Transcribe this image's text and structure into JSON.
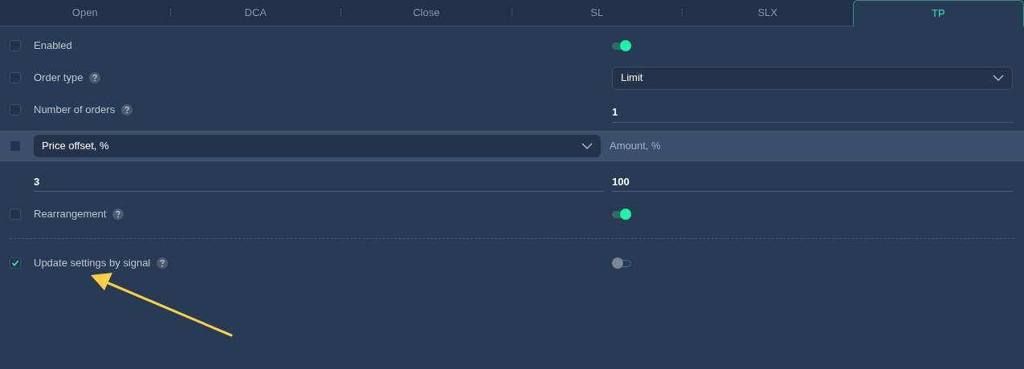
{
  "tabs": [
    {
      "label": "Open",
      "selected": false
    },
    {
      "label": "DCA",
      "selected": false
    },
    {
      "label": "Close",
      "selected": false
    },
    {
      "label": "SL",
      "selected": false
    },
    {
      "label": "SLX",
      "selected": false
    },
    {
      "label": "TP",
      "selected": true
    }
  ],
  "rows": [
    {
      "kind": "toggle",
      "label": "Enabled",
      "help": false,
      "checked": false,
      "on": true
    },
    {
      "kind": "select",
      "label": "Order type",
      "help": true,
      "checked": false,
      "value": "Limit"
    },
    {
      "kind": "number",
      "label": "Number of orders",
      "help": true,
      "checked": false,
      "value": "1"
    },
    {
      "kind": "table",
      "checked": false,
      "select": "Price offset, %",
      "column": "Amount, %",
      "values": [
        [
          "3",
          "100"
        ]
      ]
    },
    {
      "kind": "toggle",
      "label": "Rearrangement",
      "help": true,
      "checked": false,
      "on": true
    },
    {
      "kind": "divider"
    },
    {
      "kind": "toggle",
      "label": "Update settings by signal",
      "help": true,
      "checked": true,
      "on": false
    }
  ]
}
